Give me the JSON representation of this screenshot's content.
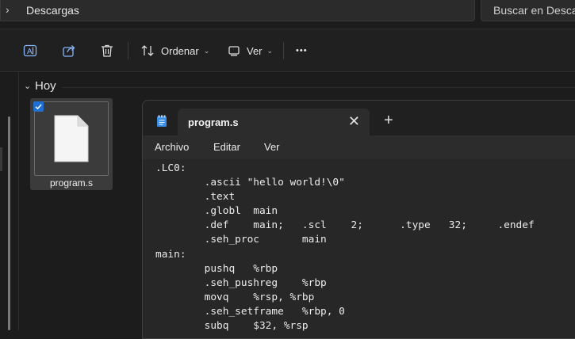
{
  "explorer": {
    "breadcrumb_chevron": "›",
    "location": "Descargas",
    "search_placeholder": "Buscar en Descargas",
    "toolbar": {
      "sort_label": "Ordenar",
      "view_label": "Ver",
      "more_label": "•••"
    },
    "group": {
      "chevron": "⌄",
      "title": "Hoy"
    },
    "files": [
      {
        "name": "program.s",
        "selected": true
      }
    ]
  },
  "notepad": {
    "tab_title": "program.s",
    "close_glyph": "✕",
    "new_tab_glyph": "+",
    "menu": [
      "Archivo",
      "Editar",
      "Ver"
    ],
    "lines": [
      ".LC0:",
      "        .ascii \"hello world!\\0\"",
      "        .text",
      "        .globl  main",
      "        .def    main;   .scl    2;      .type   32;     .endef",
      "        .seh_proc       main",
      "main:",
      "        pushq   %rbp",
      "        .seh_pushreg    %rbp",
      "        movq    %rsp, %rbp",
      "        .seh_setframe   %rbp, 0",
      "        subq    $32, %rsp"
    ]
  },
  "colors": {
    "background": "#1c1c1c",
    "accent": "#1f6fd0",
    "notepad_icon": "#3a8ee6"
  }
}
